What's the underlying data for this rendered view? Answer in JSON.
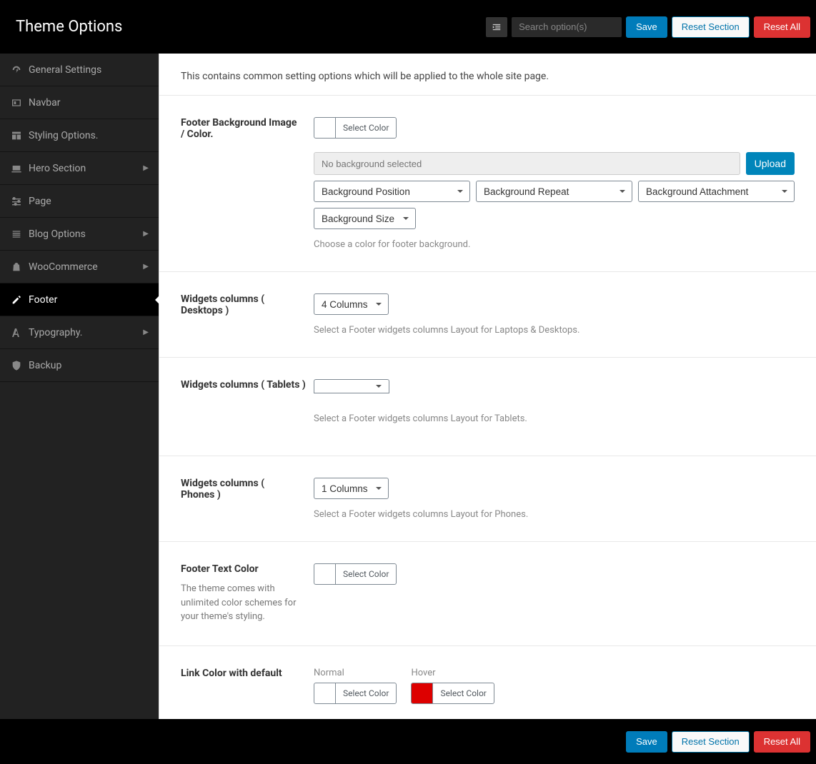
{
  "header": {
    "title": "Theme Options",
    "search_placeholder": "Search option(s)",
    "save_label": "Save",
    "reset_section_label": "Reset Section",
    "reset_all_label": "Reset All"
  },
  "sidebar": {
    "items": [
      {
        "label": "General Settings",
        "icon": "dashboard",
        "chevron": false
      },
      {
        "label": "Navbar",
        "icon": "frame",
        "chevron": false
      },
      {
        "label": "Styling Options.",
        "icon": "layout",
        "chevron": false
      },
      {
        "label": "Hero Section",
        "icon": "laptop",
        "chevron": true
      },
      {
        "label": "Page",
        "icon": "sliders",
        "chevron": false
      },
      {
        "label": "Blog Options",
        "icon": "list",
        "chevron": true
      },
      {
        "label": "WooCommerce",
        "icon": "shopping-bag",
        "chevron": true
      },
      {
        "label": "Footer",
        "icon": "edit",
        "chevron": false,
        "active": true
      },
      {
        "label": "Typography.",
        "icon": "font",
        "chevron": true
      },
      {
        "label": "Backup",
        "icon": "shield",
        "chevron": false
      }
    ]
  },
  "intro_text": "This contains common setting options which will be applied to the whole site page.",
  "settings": {
    "bg": {
      "label": "Footer Background Image / Color.",
      "select_color": "Select Color",
      "placeholder": "No background selected",
      "upload": "Upload",
      "position": "Background Position",
      "repeat": "Background Repeat",
      "attachment": "Background Attachment",
      "size": "Background Size",
      "help": "Choose a color for footer background."
    },
    "desktops": {
      "label": "Widgets columns ( Desktops )",
      "value": "4 Columns",
      "help": "Select a Footer widgets columns Layout for Laptops & Desktops."
    },
    "tablets": {
      "label": "Widgets columns ( Tablets )",
      "help": "Select a Footer widgets columns Layout for Tablets."
    },
    "phones": {
      "label": "Widgets columns ( Phones )",
      "value": "1 Columns",
      "help": "Select a Footer widgets columns Layout for Phones."
    },
    "text_color": {
      "label": "Footer Text Color",
      "sublabel": "The theme comes with unlimited color schemes for your theme's styling.",
      "select_color": "Select Color"
    },
    "link_color": {
      "label": "Link Color with default",
      "normal": "Normal",
      "hover": "Hover",
      "select_color": "Select Color",
      "hover_swatch": "#dd0000"
    }
  },
  "footer_bar": {
    "save_label": "Save",
    "reset_section_label": "Reset Section",
    "reset_all_label": "Reset All"
  }
}
